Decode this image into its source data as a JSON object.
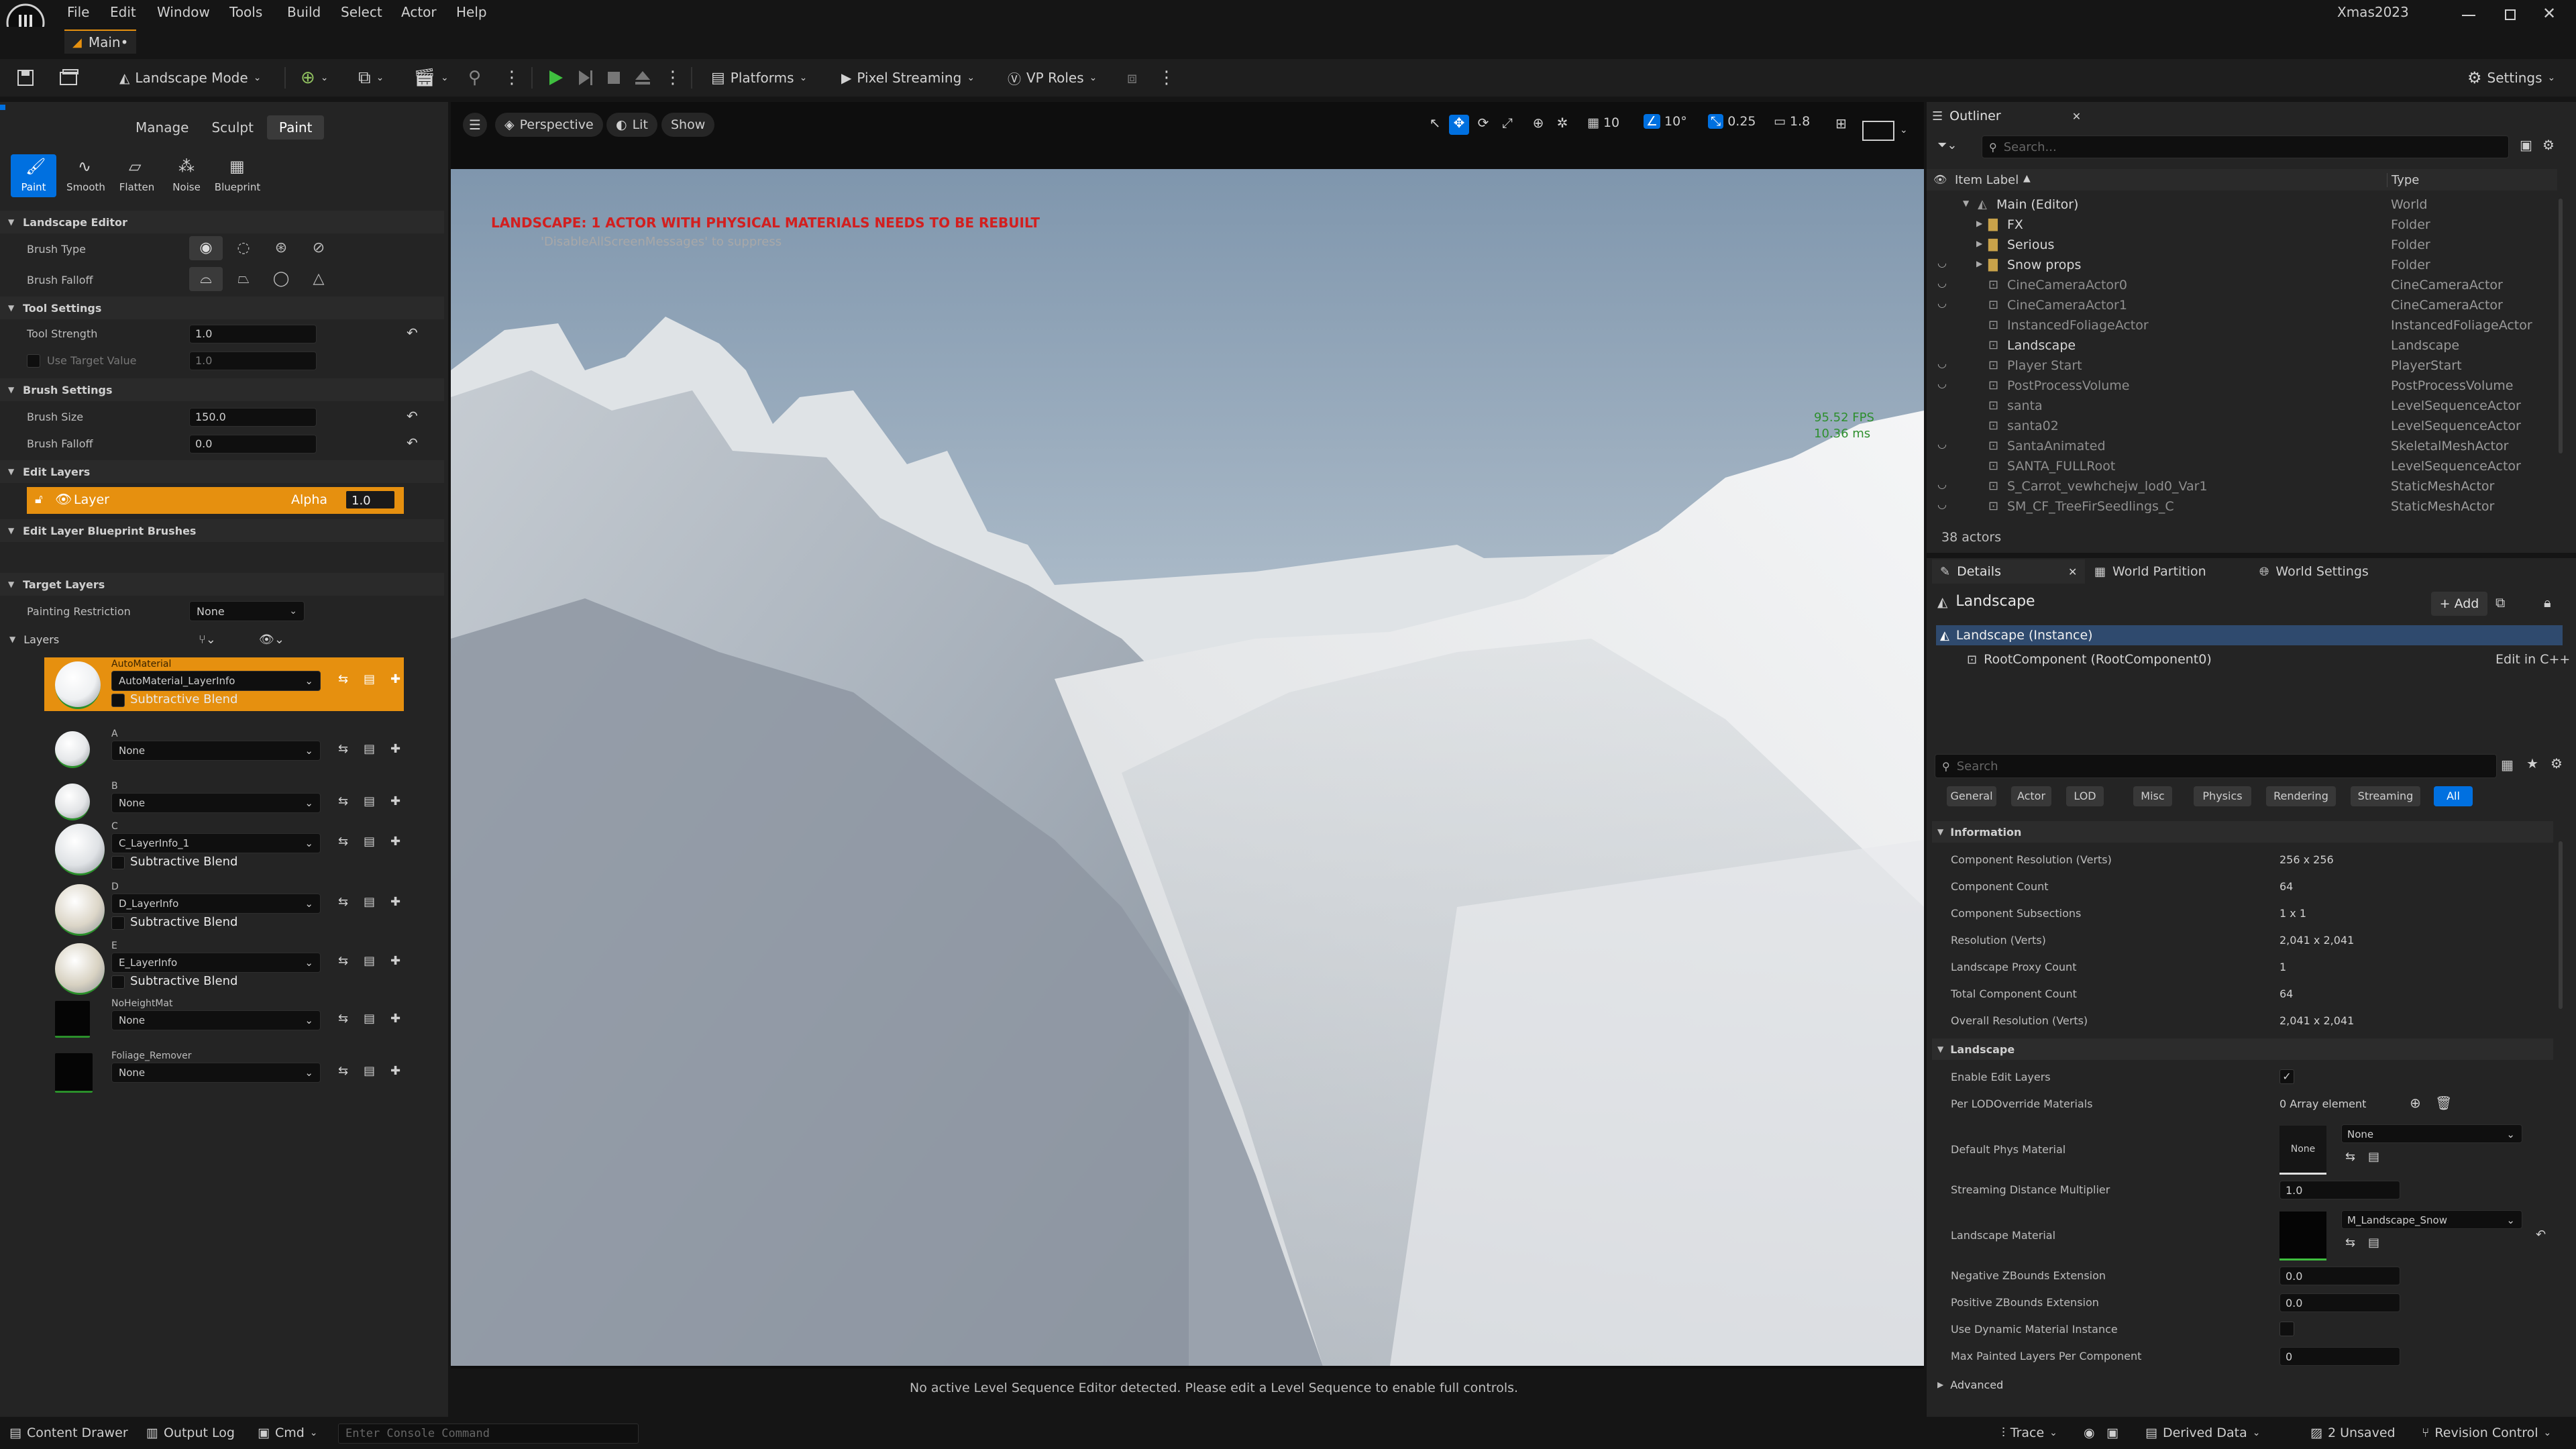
{
  "menubar": {
    "items": [
      "File",
      "Edit",
      "Window",
      "Tools",
      "Build",
      "Select",
      "Actor",
      "Help"
    ],
    "project": "Xmas2023"
  },
  "doc_tab": {
    "label": "Main•"
  },
  "toolbar": {
    "mode_label": "Landscape Mode",
    "platforms_label": "Platforms",
    "pixel_streaming_label": "Pixel Streaming",
    "vp_roles_label": "VP Roles",
    "settings_label": "Settings"
  },
  "landscape_panel": {
    "mode_tabs": [
      "Manage",
      "Sculpt",
      "Paint"
    ],
    "active_mode_tab": "Paint",
    "tools": [
      "Paint",
      "Smooth",
      "Flatten",
      "Noise",
      "Blueprint"
    ],
    "active_tool": "Paint",
    "section_editor": "Landscape Editor",
    "brush_type_label": "Brush Type",
    "brush_falloff_label": "Brush Falloff",
    "section_tool_settings": "Tool Settings",
    "tool_strength_label": "Tool Strength",
    "tool_strength_value": "1.0",
    "use_target_value_label": "Use Target Value",
    "use_target_value_value": "1.0",
    "section_brush_settings": "Brush Settings",
    "brush_size_label": "Brush Size",
    "brush_size_value": "150.0",
    "brush_falloff_setting_label": "Brush Falloff",
    "brush_falloff_setting_value": "0.0",
    "section_edit_layers": "Edit Layers",
    "edit_layer_name": "Layer",
    "edit_layer_alpha_label": "Alpha",
    "edit_layer_alpha_value": "1.0",
    "section_blueprint_brushes": "Edit Layer Blueprint Brushes",
    "section_target_layers": "Target Layers",
    "painting_restriction_label": "Painting Restriction",
    "painting_restriction_value": "None",
    "layers_label": "Layers",
    "layers": [
      {
        "name": "AutoMaterial",
        "info": "AutoMaterial_LayerInfo",
        "blend": "Subtractive Blend"
      },
      {
        "name": "A",
        "info": "None",
        "blend": ""
      },
      {
        "name": "B",
        "info": "None",
        "blend": ""
      },
      {
        "name": "C",
        "info": "C_LayerInfo_1",
        "blend": "Subtractive Blend"
      },
      {
        "name": "D",
        "info": "D_LayerInfo",
        "blend": "Subtractive Blend"
      },
      {
        "name": "E",
        "info": "E_LayerInfo",
        "blend": "Subtractive Blend"
      },
      {
        "name": "NoHeightMat",
        "info": "None",
        "blend": ""
      },
      {
        "name": "Foliage_Remover",
        "info": "None",
        "blend": ""
      }
    ]
  },
  "viewport": {
    "perspective_label": "Perspective",
    "lit_label": "Lit",
    "show_label": "Show",
    "grid_snap": "10",
    "rot_snap": "10°",
    "scale_snap": "0.25",
    "cam_speed": "1.8",
    "warning": "LANDSCAPE: 1 ACTOR WITH PHYSICAL MATERIALS NEEDS TO BE REBUILT",
    "suppress_hint": "'DisableAllScreenMessages' to suppress",
    "fps": "95.52 FPS",
    "ms": "10.36 ms",
    "footer_message": "No active Level Sequence Editor detected. Please edit a Level Sequence to enable full controls."
  },
  "outliner": {
    "title": "Outliner",
    "search_placeholder": "Search...",
    "col_label": "Item Label",
    "col_type": "Type",
    "rows": [
      {
        "name": "Main (Editor)",
        "type": "World"
      },
      {
        "name": "FX",
        "type": "Folder"
      },
      {
        "name": "Serious",
        "type": "Folder"
      },
      {
        "name": "Snow props",
        "type": "Folder"
      },
      {
        "name": "CineCameraActor0",
        "type": "CineCameraActor"
      },
      {
        "name": "CineCameraActor1",
        "type": "CineCameraActor"
      },
      {
        "name": "InstancedFoliageActor",
        "type": "InstancedFoliageActor"
      },
      {
        "name": "Landscape",
        "type": "Landscape"
      },
      {
        "name": "Player Start",
        "type": "PlayerStart"
      },
      {
        "name": "PostProcessVolume",
        "type": "PostProcessVolume"
      },
      {
        "name": "santa",
        "type": "LevelSequenceActor"
      },
      {
        "name": "santa02",
        "type": "LevelSequenceActor"
      },
      {
        "name": "SantaAnimated",
        "type": "SkeletalMeshActor"
      },
      {
        "name": "SANTA_FULLRoot",
        "type": "LevelSequenceActor"
      },
      {
        "name": "S_Carrot_vewhchejw_lod0_Var1",
        "type": "StaticMeshActor"
      },
      {
        "name": "SM_CF_TreeFirSeedlings_C",
        "type": "StaticMeshActor"
      }
    ],
    "actor_count": "38 actors"
  },
  "details": {
    "tabs": [
      "Details",
      "World Partition",
      "World Settings"
    ],
    "actor_name": "Landscape",
    "add_label": "+ Add",
    "instance_label": "Landscape (Instance)",
    "root_component": "RootComponent (RootComponent0)",
    "edit_in_cpp": "Edit in C++",
    "search_placeholder": "Search",
    "filter_chips": [
      "General",
      "Actor",
      "LOD",
      "Misc",
      "Physics",
      "Rendering",
      "Streaming",
      "All"
    ],
    "active_chip": "All",
    "section_information": "Information",
    "info_rows": [
      {
        "k": "Component Resolution (Verts)",
        "v": "256 x 256"
      },
      {
        "k": "Component Count",
        "v": "64"
      },
      {
        "k": "Component Subsections",
        "v": "1 x 1"
      },
      {
        "k": "Resolution (Verts)",
        "v": "2,041 x 2,041"
      },
      {
        "k": "Landscape Proxy Count",
        "v": "1"
      },
      {
        "k": "Total Component Count",
        "v": "64"
      },
      {
        "k": "Overall Resolution (Verts)",
        "v": "2,041 x 2,041"
      }
    ],
    "section_landscape": "Landscape",
    "enable_edit_layers": "Enable Edit Layers",
    "per_lod_override": "Per LODOverride Materials",
    "array_element": "0 Array element",
    "default_phys_material": "Default Phys Material",
    "phys_thumb_label": "None",
    "phys_value": "None",
    "streaming_distance": "Streaming Distance Multiplier",
    "streaming_distance_value": "1.0",
    "landscape_material": "Landscape Material",
    "landscape_material_value": "M_Landscape_Snow",
    "neg_zbounds": "Negative ZBounds Extension",
    "neg_zbounds_value": "0.0",
    "pos_zbounds": "Positive ZBounds Extension",
    "pos_zbounds_value": "0.0",
    "dynamic_material": "Use Dynamic Material Instance",
    "max_painted": "Max Painted Layers Per Component",
    "max_painted_value": "0",
    "advanced": "Advanced"
  },
  "statusbar": {
    "content_drawer": "Content Drawer",
    "output_log": "Output Log",
    "cmd": "Cmd",
    "console_placeholder": "Enter Console Command",
    "trace": "Trace",
    "derived_data": "Derived Data",
    "unsaved": "2 Unsaved",
    "revision_control": "Revision Control"
  },
  "colors": {
    "accent_orange": "#e6900f",
    "accent_blue": "#0070e0",
    "warning_red": "#d21f1f",
    "play_green": "#3fbf3f"
  }
}
